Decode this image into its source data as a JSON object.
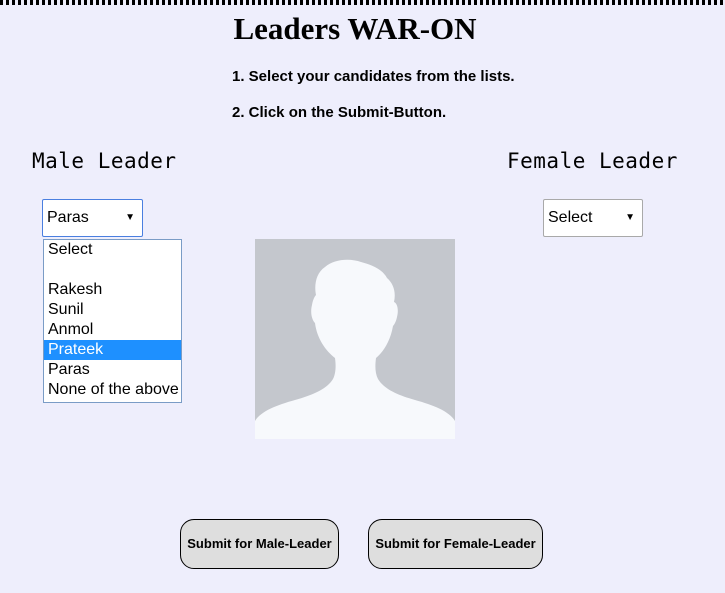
{
  "page": {
    "title": "Leaders WAR-ON",
    "instructions": [
      "1. Select your candidates from the lists.",
      "2. Click on the Submit-Button."
    ]
  },
  "male": {
    "label": "Male Leader",
    "select_value": "Paras",
    "options": [
      "Select",
      "",
      "Rakesh",
      "Sunil",
      "Anmol",
      "Prateek",
      "Paras",
      "None of the above"
    ],
    "highlighted_option": "Prateek"
  },
  "female": {
    "label": "Female Leader",
    "select_value": "Select"
  },
  "buttons": {
    "submit_male": "Submit for Male-Leader",
    "submit_female": "Submit for Female-Leader"
  },
  "colors": {
    "background": "#eeeefc",
    "highlight": "#1e90ff",
    "avatar_bg": "#c4c7cd",
    "avatar_figure": "#f7f9fc"
  },
  "icons": {
    "avatar": "person-silhouette-icon",
    "caret": "caret-down-icon"
  }
}
